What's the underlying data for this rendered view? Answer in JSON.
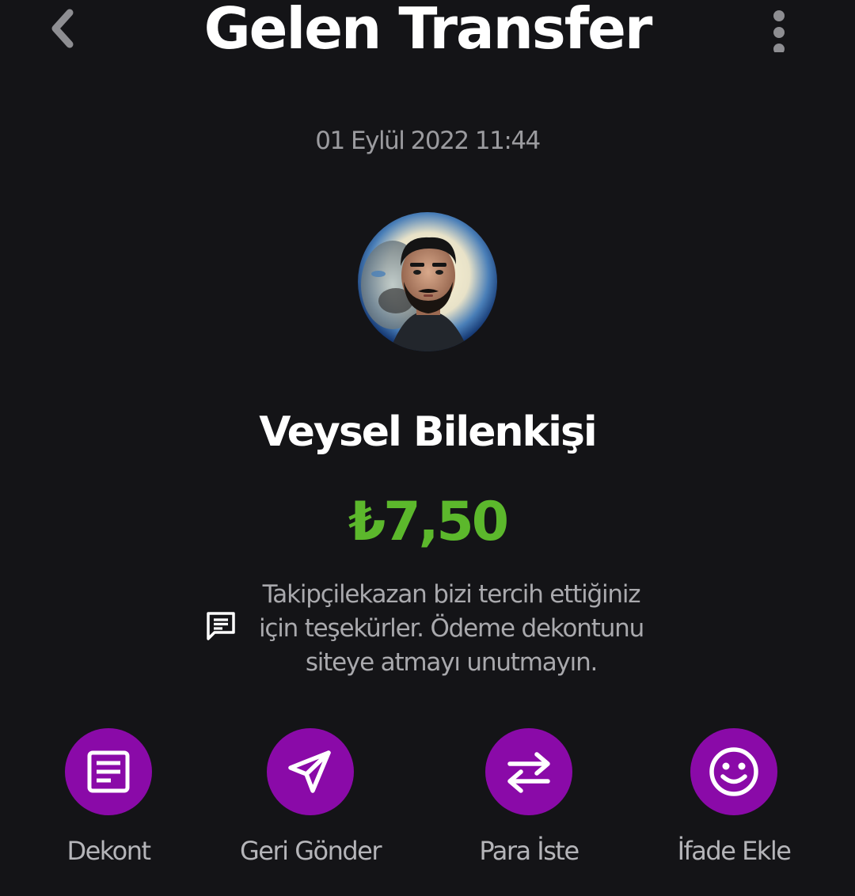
{
  "header": {
    "title": "Gelen Transfer",
    "back_icon": "chevron-left-icon",
    "more_icon": "more-vertical-icon"
  },
  "transaction": {
    "date": "01 Eylül 2022 11:44",
    "sender_name": "Veysel Bilenkişi",
    "amount": "₺7,50",
    "amount_color": "#5cb82c",
    "message": "Takipçilekazan bizi tercih ettiğiniz için teşekürler. Ödeme dekontunu siteye atmayı unutmayın."
  },
  "actions": [
    {
      "label": "Dekont",
      "icon": "receipt-icon"
    },
    {
      "label": "Geri Gönder",
      "icon": "send-icon"
    },
    {
      "label": "Para İste",
      "icon": "swap-arrows-icon"
    },
    {
      "label": "İfade Ekle",
      "icon": "smiley-icon"
    }
  ],
  "colors": {
    "background": "#141417",
    "accent": "#8a0aa8",
    "text_primary": "#ffffff",
    "text_secondary": "#9b9b9f"
  }
}
